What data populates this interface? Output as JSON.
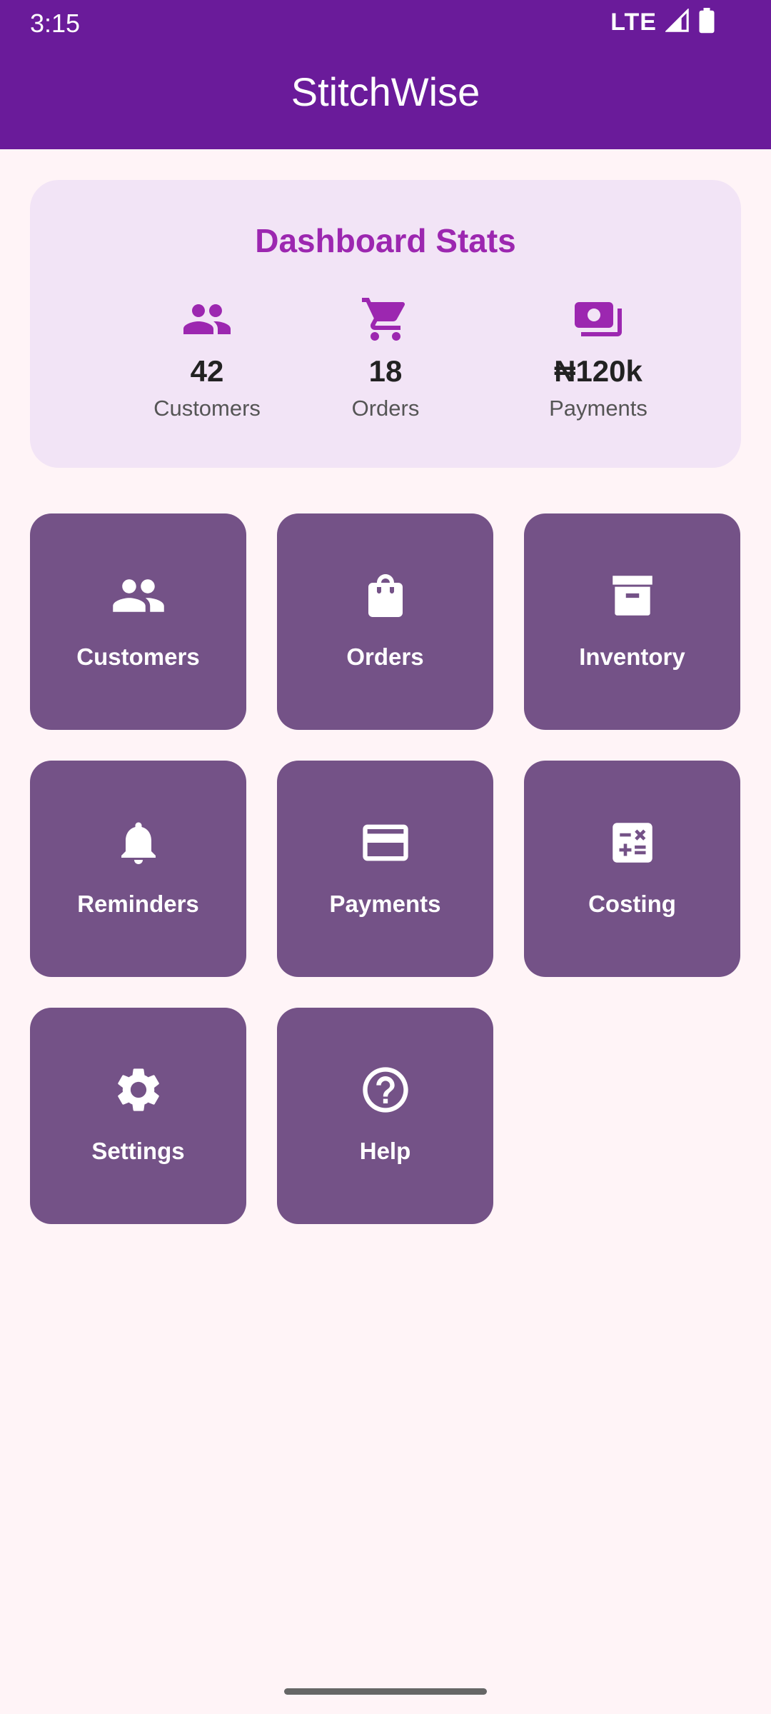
{
  "status_bar": {
    "time": "3:15",
    "network": "LTE"
  },
  "app_bar": {
    "title": "StitchWise",
    "color": "#6a1b9a"
  },
  "stats": {
    "title": "Dashboard Stats",
    "accent": "#9c27b0",
    "items": [
      {
        "icon": "people-icon",
        "value": "42",
        "label": "Customers"
      },
      {
        "icon": "cart-icon",
        "value": "18",
        "label": "Orders"
      },
      {
        "icon": "money-icon",
        "value": "₦120k",
        "label": "Payments"
      }
    ]
  },
  "menu": {
    "tile_color": "#745287",
    "items": [
      {
        "icon": "people-icon",
        "label": "Customers"
      },
      {
        "icon": "shopping-bag-icon",
        "label": "Orders"
      },
      {
        "icon": "archive-box-icon",
        "label": "Inventory"
      },
      {
        "icon": "bell-icon",
        "label": "Reminders"
      },
      {
        "icon": "credit-card-icon",
        "label": "Payments"
      },
      {
        "icon": "calculator-icon",
        "label": "Costing"
      },
      {
        "icon": "gear-icon",
        "label": "Settings"
      },
      {
        "icon": "help-circle-icon",
        "label": "Help"
      }
    ]
  }
}
